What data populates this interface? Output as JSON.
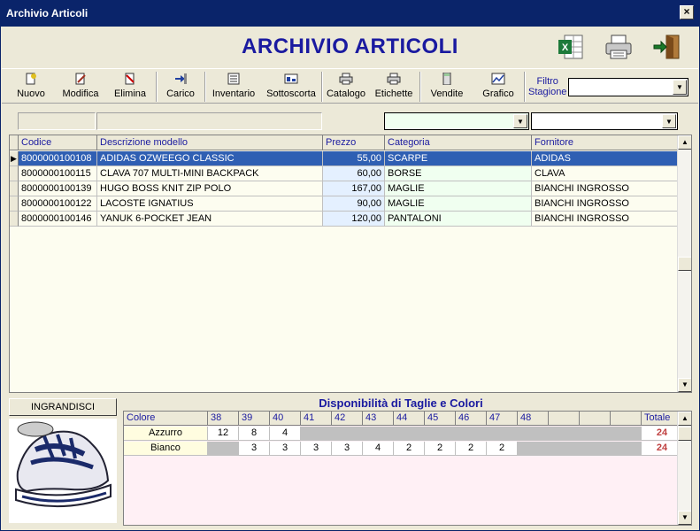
{
  "window": {
    "title": "Archivio Articoli",
    "close_label": "×"
  },
  "header": {
    "app_title": "ARCHIVIO ARTICOLI",
    "icons": [
      "excel-icon",
      "printer-icon",
      "exit-door-icon"
    ]
  },
  "toolbar": {
    "items": [
      {
        "name": "nuovo",
        "label": "Nuovo",
        "icon": "new-icon"
      },
      {
        "name": "modifica",
        "label": "Modifica",
        "icon": "edit-icon"
      },
      {
        "name": "elimina",
        "label": "Elimina",
        "icon": "delete-icon"
      },
      {
        "name": "carico",
        "label": "Carico",
        "icon": "load-icon"
      },
      {
        "name": "inventario",
        "label": "Inventario",
        "icon": "inventory-icon"
      },
      {
        "name": "sottoscorta",
        "label": "Sottoscorta",
        "icon": "understock-icon"
      },
      {
        "name": "catalogo",
        "label": "Catalogo",
        "icon": "catalog-printer-icon"
      },
      {
        "name": "etichette",
        "label": "Etichette",
        "icon": "labels-printer-icon"
      },
      {
        "name": "vendite",
        "label": "Vendite",
        "icon": "calculator-icon"
      },
      {
        "name": "grafico",
        "label": "Grafico",
        "icon": "chart-icon"
      }
    ],
    "filtro_label_1": "Filtro",
    "filtro_label_2": "Stagione",
    "filtro_value": ""
  },
  "filters": {
    "codice": "",
    "descrizione": "",
    "categoria": "",
    "fornitore": ""
  },
  "grid": {
    "columns": [
      "Codice",
      "Descrizione modello",
      "Prezzo",
      "Categoria",
      "Fornitore"
    ],
    "rows": [
      [
        "8000000100108",
        "ADIDAS OZWEEGO CLASSIC",
        "55,00",
        "SCARPE",
        "ADIDAS"
      ],
      [
        "8000000100115",
        "CLAVA 707 MULTI-MINI BACKPACK",
        "60,00",
        "BORSE",
        "CLAVA"
      ],
      [
        "8000000100139",
        "HUGO BOSS KNIT ZIP POLO",
        "167,00",
        "MAGLIE",
        "BIANCHI INGROSSO"
      ],
      [
        "8000000100122",
        "LACOSTE IGNATIUS",
        "90,00",
        "MAGLIE",
        "BIANCHI INGROSSO"
      ],
      [
        "8000000100146",
        "YANUK 6-POCKET JEAN",
        "120,00",
        "PANTALONI",
        "BIANCHI INGROSSO"
      ]
    ],
    "selected_row": 0
  },
  "ingrandisci_label": "INGRANDISCI",
  "disponibilita": {
    "title": "Disponibilità di Taglie e Colori",
    "colore_label": "Colore",
    "totale_label": "Totale",
    "sizes": [
      "38",
      "39",
      "40",
      "41",
      "42",
      "43",
      "44",
      "45",
      "46",
      "47",
      "48",
      "",
      "",
      ""
    ],
    "rows": [
      {
        "colore": "Azzurro",
        "values": [
          "12",
          "8",
          "4",
          "",
          "",
          "",
          "",
          "",
          "",
          "",
          "",
          "",
          "",
          ""
        ],
        "totale": "24"
      },
      {
        "colore": "Bianco",
        "values": [
          "",
          "3",
          "3",
          "3",
          "3",
          "4",
          "2",
          "2",
          "2",
          "2",
          "",
          "",
          "",
          ""
        ],
        "totale": "24"
      }
    ]
  },
  "colors": {
    "accent": "#1a1aa0",
    "selection": "#2f5fb3",
    "titlebar": "#0a246a",
    "total": "#c04040"
  }
}
